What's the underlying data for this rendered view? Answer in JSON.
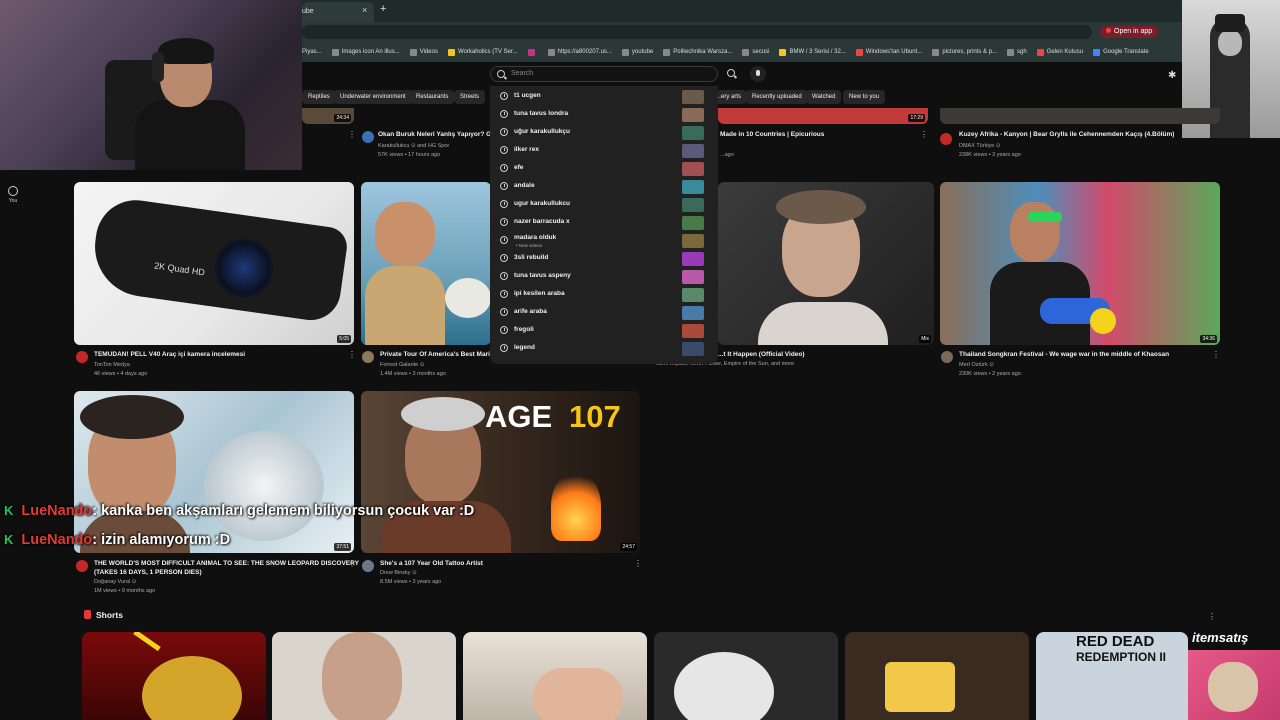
{
  "browser": {
    "tab_title": "ube",
    "tab_close": "×",
    "new_tab": "+",
    "open_in_app": "Open in app",
    "bookmarks": [
      "Piyas...",
      "Images icon An illus...",
      "Videos",
      "Workaholics (TV Ser...",
      "",
      "https://a800207.us...",
      "youtube",
      "Politechnika Warsza...",
      "secusi",
      "BMW / 3 Serisi / 32...",
      "Windows'tan Ubunt...",
      "pictures, prints & p...",
      "sgh",
      "Gelen Kutusu",
      "Google Translate"
    ]
  },
  "search": {
    "placeholder": "Search",
    "suggestions": [
      {
        "text": "t1 ucgen",
        "sub": ""
      },
      {
        "text": "tuna tavus londra",
        "sub": ""
      },
      {
        "text": "uğur karakullukçu",
        "sub": ""
      },
      {
        "text": "ilker rex",
        "sub": ""
      },
      {
        "text": "efe",
        "sub": ""
      },
      {
        "text": "andale",
        "sub": ""
      },
      {
        "text": "ugur karakullukcu",
        "sub": ""
      },
      {
        "text": "nazer barracuda x",
        "sub": ""
      },
      {
        "text": "madara olduk",
        "sub": "• New videos"
      },
      {
        "text": "3sli rebuild",
        "sub": ""
      },
      {
        "text": "tuna tavus aspeny",
        "sub": ""
      },
      {
        "text": "ipi kesilen araba",
        "sub": ""
      },
      {
        "text": "arife araba",
        "sub": ""
      },
      {
        "text": "fregoli",
        "sub": ""
      },
      {
        "text": "legend",
        "sub": ""
      }
    ]
  },
  "chips": [
    "Reptiles",
    "Underwater environment",
    "Restaurants",
    "Streets",
    "...ery arts",
    "Recently uploaded",
    "Watched",
    "New to you"
  ],
  "rail": {
    "you": "You"
  },
  "row0": [
    {
      "duration": "24:34",
      "title": "Okan Buruk Neleri Yanlış Yapıyor? Galat",
      "channel": "Karakullukcu ⊙ and HG Spor",
      "meta": "57K views • 17 hours ago"
    },
    {
      "duration": "17:29",
      "title": "Made in 10 Countries | Epicurious",
      "channel": "",
      "meta": "...ago"
    },
    {
      "duration": "",
      "title": "Kuzey Afrika - Kanyon | Bear Grylls ile Cehennemden Kaçış (4.Bölüm)",
      "channel": "DMAX Türkiye ⊙",
      "meta": "238K views • 3 years ago"
    }
  ],
  "row1": [
    {
      "duration": "5:05",
      "title": "TEMUDAN! PELL V40 Araç içi kamera incelemesi",
      "channel": "TonTon Medya",
      "meta": "46 views • 4 days ago",
      "thumb_text": "2K Quad HD"
    },
    {
      "duration": "",
      "title": "Private Tour Of America's Best Marine",
      "channel": "Forrest Galante ⊙",
      "meta": "1.4M views • 3 months ago",
      "thumb_text": ""
    },
    {
      "duration": "Mix",
      "title": "...t It Happen (Official Video)",
      "channel": "Tame Impala, Kevin Parker, Empire of the Sun, and more",
      "meta": "",
      "thumb_text": ""
    },
    {
      "duration": "34:36",
      "title": "Thailand Songkran Festival - We wage war in the middle of Khaosan",
      "channel": "Mert Öztürk ⊙",
      "meta": "230K views • 2 years ago",
      "thumb_text": ""
    }
  ],
  "row2": [
    {
      "duration": "37:51",
      "title": "THE WORLD'S MOST DIFFICULT ANIMAL TO SEE: THE SNOW LEOPARD DISCOVERY",
      "title2": "(TAKES 16 DAYS, 1 PERSON DIES)",
      "channel": "Doğanay Vural ⊙",
      "meta": "1M views • 9 months ago"
    },
    {
      "duration": "24:57",
      "title": "She's a 107 Year Old Tattoo Artist",
      "channel": "Drew Binsky ⊙",
      "meta": "8.5M views • 3 years ago",
      "thumb_text_a": "AGE",
      "thumb_text_b": "107"
    }
  ],
  "chat": [
    {
      "badge": "K",
      "name": "LueNando",
      "message": ": kanka ben akşamları gelemem biliyorsun çocuk var :D"
    },
    {
      "badge": "K",
      "name": "LueNando",
      "message": ": izin alamıyorum :D"
    }
  ],
  "shorts": {
    "heading": "Shorts",
    "rdr_line1": "RED DEAD",
    "rdr_line2": "REDEMPTION II"
  },
  "watermark": "itemsatış",
  "colors": {
    "bg": "#0f0f0f",
    "accent": "#e53935",
    "chat_badge": "#22c55e"
  }
}
